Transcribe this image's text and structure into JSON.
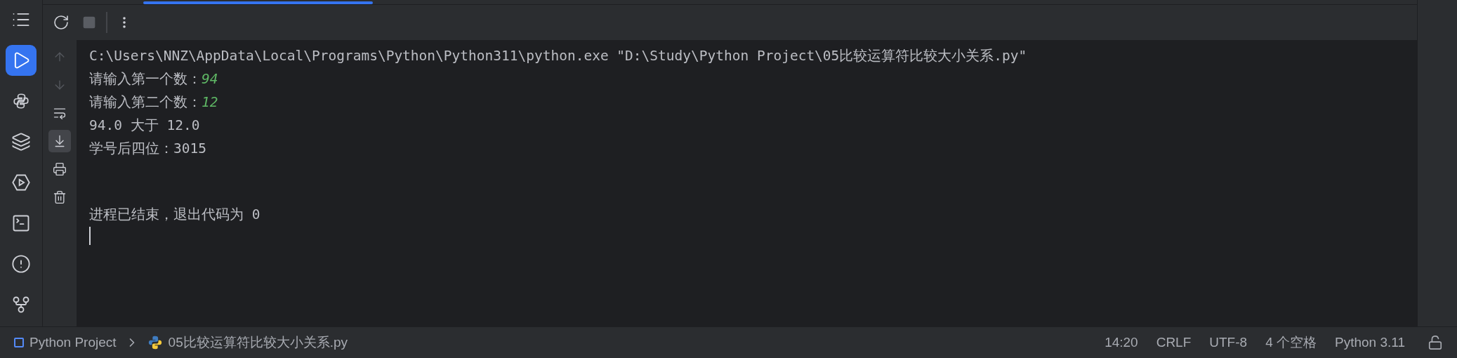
{
  "sidebar": {
    "items": [
      {
        "kind": "menu",
        "selected": false
      },
      {
        "kind": "run",
        "selected": true
      },
      {
        "kind": "python",
        "selected": false
      },
      {
        "kind": "layers",
        "selected": false
      },
      {
        "kind": "services",
        "selected": false
      },
      {
        "kind": "terminal",
        "selected": false
      },
      {
        "kind": "problems",
        "selected": false
      },
      {
        "kind": "git",
        "selected": false
      }
    ]
  },
  "run_toolbar": {
    "tab_selected": true,
    "buttons": [
      {
        "kind": "rerun",
        "disabled": false
      },
      {
        "kind": "stop",
        "disabled": true
      },
      {
        "kind": "more",
        "disabled": false
      }
    ]
  },
  "console_gutter": [
    {
      "kind": "up",
      "disabled": true,
      "selected": false
    },
    {
      "kind": "down",
      "disabled": true,
      "selected": false
    },
    {
      "kind": "wrap",
      "disabled": false,
      "selected": false
    },
    {
      "kind": "scroll_end",
      "disabled": false,
      "selected": true
    },
    {
      "kind": "print",
      "disabled": false,
      "selected": false
    },
    {
      "kind": "trash",
      "disabled": false,
      "selected": false
    }
  ],
  "console": {
    "lines": [
      [
        {
          "kind": "output",
          "text": "C:\\Users\\NNZ\\AppData\\Local\\Programs\\Python\\Python311\\python.exe \"D:\\Study\\Python Project\\05比较运算符比较大小关系.py\""
        }
      ],
      [
        {
          "kind": "output",
          "text": "请输入第一个数："
        },
        {
          "kind": "input",
          "text": "94"
        }
      ],
      [
        {
          "kind": "output",
          "text": "请输入第二个数："
        },
        {
          "kind": "input",
          "text": "12"
        }
      ],
      [
        {
          "kind": "output",
          "text": "94.0 大于 12.0"
        }
      ],
      [
        {
          "kind": "output",
          "text": "学号后四位：3015"
        }
      ],
      {
        "gap_before": true,
        "segments": [
          {
            "kind": "output",
            "text": "进程已结束，退出代码为 0"
          }
        ]
      }
    ],
    "cursor": true
  },
  "status_bar": {
    "breadcrumb": [
      {
        "kind": "project",
        "text": "Python Project"
      },
      {
        "kind": "file",
        "text": "05比较运算符比较大小关系.py"
      }
    ],
    "items": [
      {
        "kind": "text",
        "text": "14:20"
      },
      {
        "kind": "text",
        "text": "CRLF"
      },
      {
        "kind": "text",
        "text": "UTF-8"
      },
      {
        "kind": "text",
        "text": "4 个空格"
      },
      {
        "kind": "text",
        "text": "Python 3.11"
      },
      {
        "kind": "lock"
      }
    ]
  }
}
